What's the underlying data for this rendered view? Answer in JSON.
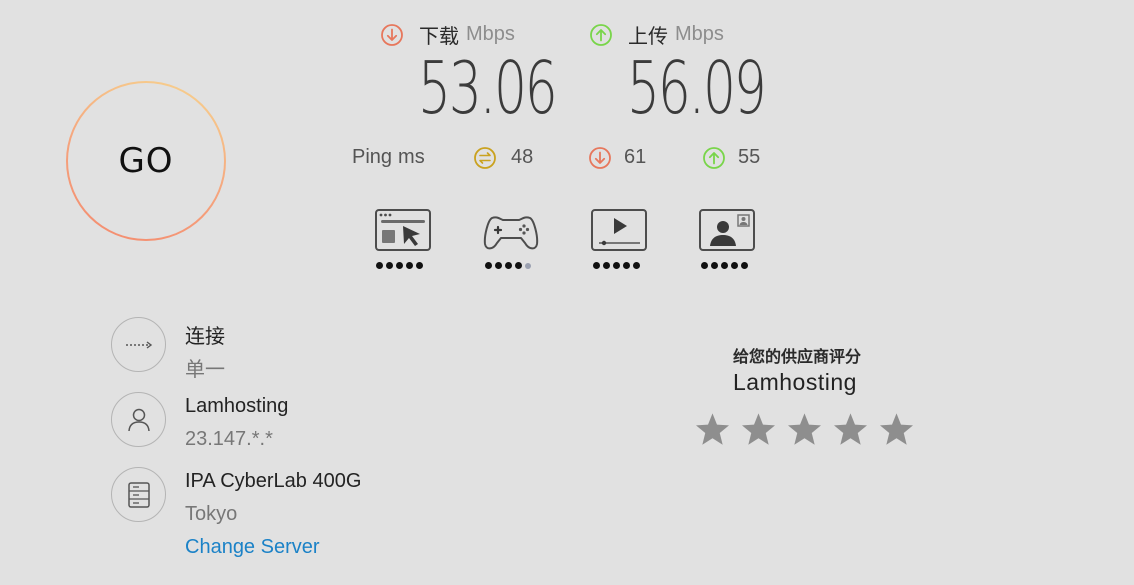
{
  "go_button": {
    "label": "GO"
  },
  "download": {
    "label": "下载",
    "unit": "Mbps",
    "value": "53.06",
    "icon": "arrow-down-circle-icon",
    "color": "#e7775c"
  },
  "upload": {
    "label": "上传",
    "unit": "Mbps",
    "value": "56.09",
    "icon": "arrow-up-circle-icon",
    "color": "#79d54a"
  },
  "ping": {
    "label": "Ping",
    "unit": "ms",
    "idle": {
      "value": "48",
      "icon": "ping-idle-icon",
      "color": "#caa21f"
    },
    "download": {
      "value": "61",
      "icon": "arrow-down-circle-icon",
      "color": "#e7775c"
    },
    "upload": {
      "value": "55",
      "icon": "arrow-up-circle-icon",
      "color": "#79d54a"
    }
  },
  "app_ratings": [
    {
      "name": "web-browsing-icon",
      "rating": 5,
      "max": 5
    },
    {
      "name": "gaming-icon",
      "rating": 4,
      "max": 5
    },
    {
      "name": "video-streaming-icon",
      "rating": 5,
      "max": 5
    },
    {
      "name": "video-chat-icon",
      "rating": 5,
      "max": 5
    }
  ],
  "connection": {
    "title": "连接",
    "value": "单一",
    "icon": "connections-icon"
  },
  "provider": {
    "name": "Lamhosting",
    "ip": "23.147.*.*",
    "icon": "user-icon"
  },
  "server": {
    "name": "IPA CyberLab 400G",
    "location": "Tokyo",
    "change_label": "Change Server",
    "icon": "server-icon"
  },
  "rating": {
    "title": "给您的供应商评分",
    "provider": "Lamhosting",
    "stars": 5,
    "star_color": "#8e8e8e"
  }
}
